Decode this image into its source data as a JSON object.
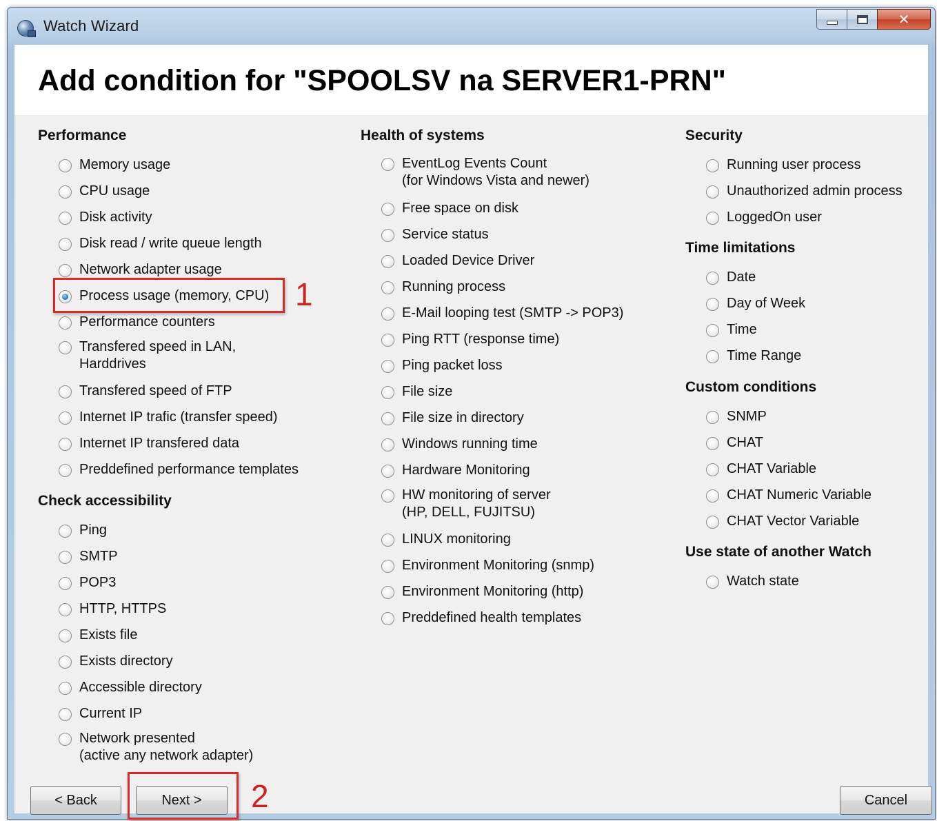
{
  "window": {
    "title": "Watch Wizard"
  },
  "heading": "Add condition for \"SPOOLSV na SERVER1-PRN\"",
  "performance": {
    "title": "Performance",
    "items": [
      "Memory usage",
      "CPU usage",
      "Disk activity",
      "Disk read / write queue length",
      "Network adapter usage",
      "Process usage (memory, CPU)",
      "Performance counters",
      [
        "Transfered speed in LAN,",
        "Harddrives"
      ],
      "Transfered speed of FTP",
      "Internet IP trafic (transfer speed)",
      "Internet IP transfered data",
      "Preddefined performance templates"
    ],
    "selected": "Process usage (memory, CPU)"
  },
  "accessibility": {
    "title": "Check accessibility",
    "items": [
      "Ping",
      "SMTP",
      "POP3",
      "HTTP, HTTPS",
      "Exists file",
      "Exists directory",
      "Accessible directory",
      "Current IP",
      [
        "Network presented",
        "(active any network adapter)"
      ]
    ]
  },
  "health": {
    "title": "Health of systems",
    "items": [
      [
        "EventLog Events Count",
        "(for Windows Vista and newer)"
      ],
      "Free space on disk",
      "Service status",
      "Loaded Device Driver",
      "Running process",
      "E-Mail looping test (SMTP -> POP3)",
      "Ping RTT (response time)",
      "Ping packet loss",
      "File size",
      "File size in directory",
      "Windows running time",
      "Hardware Monitoring",
      [
        "HW monitoring of server",
        "(HP, DELL, FUJITSU)"
      ],
      "LINUX monitoring",
      "Environment Monitoring (snmp)",
      "Environment Monitoring (http)",
      "Preddefined health templates"
    ]
  },
  "security": {
    "title": "Security",
    "items": [
      "Running user process",
      "Unauthorized admin process",
      "LoggedOn user"
    ]
  },
  "time": {
    "title": "Time limitations",
    "items": [
      "Date",
      "Day of Week",
      "Time",
      "Time Range"
    ]
  },
  "custom": {
    "title": "Custom conditions",
    "items": [
      "SNMP",
      "CHAT",
      "CHAT Variable",
      "CHAT Numeric Variable",
      "CHAT Vector Variable"
    ]
  },
  "another_watch": {
    "title": "Use state of another Watch",
    "items": [
      "Watch state"
    ]
  },
  "buttons": {
    "back": "< Back",
    "next": "Next >",
    "cancel": "Cancel"
  },
  "annotations": {
    "marker1": "1",
    "marker2": "2"
  },
  "colors": {
    "annotation": "#d42e2a",
    "radio_checked": "#2e78c9"
  }
}
